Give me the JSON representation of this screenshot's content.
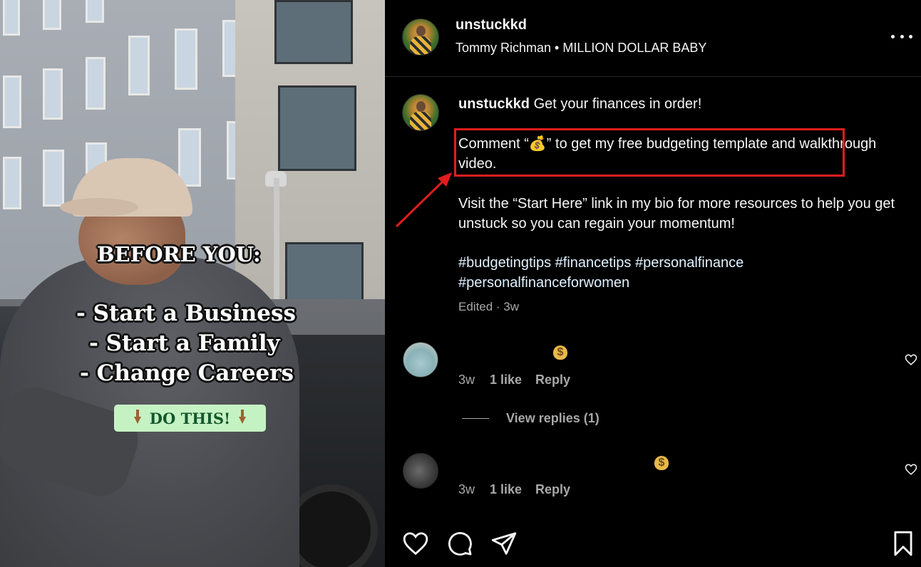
{
  "video": {
    "overlay_title": "BEFORE YOU:",
    "overlay_lines": [
      "- Start a Business",
      "- Start a Family",
      "- Change Careers"
    ],
    "cta_label": "DO THIS!",
    "cta_bg": "#c5f2c3",
    "cta_text_color": "#14572c",
    "cta_icons": [
      "point-down-icon",
      "point-down-icon"
    ]
  },
  "header": {
    "username": "unstuckkd",
    "audio": "Tommy Richman • MILLION DOLLAR BABY",
    "more_icon": "more-horizontal-icon"
  },
  "caption": {
    "username": "unstuckkd",
    "first_line": " Get your finances in order!",
    "paragraph1": "Comment “💰” to get my free budgeting template and walkthrough video.",
    "paragraph2": "Visit the “Start Here” link in my bio for more resources to help you get unstuck so you can regain your momentum!",
    "hashtags": "#budgetingtips #financetips #personalfinance #personalfinanceforwomen",
    "meta": "Edited · 3w",
    "highlight_color": "#e11d1d",
    "hashtag_color": "#e0f1ff"
  },
  "comments": [
    {
      "text_icon": "money-bag-icon",
      "time": "3w",
      "likes": "1 like",
      "reply": "Reply"
    },
    {
      "text_icon": "money-bag-icon",
      "time": "3w",
      "likes": "1 like",
      "reply": "Reply"
    }
  ],
  "view_replies": "View replies (1)",
  "actions": [
    "heart-icon",
    "comment-icon",
    "share-icon",
    "bookmark-icon"
  ]
}
